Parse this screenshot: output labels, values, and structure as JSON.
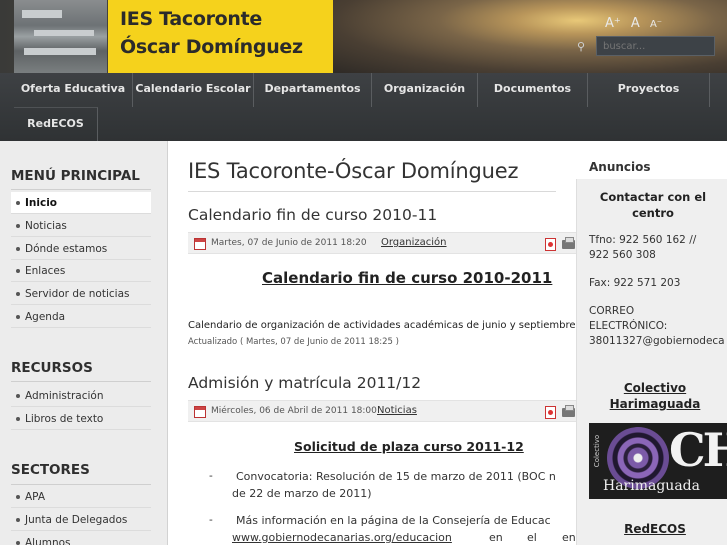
{
  "header": {
    "school_line1": "IES Tacoronte",
    "school_line2": "Óscar Domínguez",
    "font_controls": [
      "A⁺",
      "A",
      "A⁻"
    ],
    "search_placeholder": "buscar..."
  },
  "nav": {
    "items": [
      "Oferta Educativa",
      "Calendario Escolar",
      "Departamentos",
      "Organización",
      "Documentos",
      "Proyectos",
      "RedECOS"
    ]
  },
  "left_sidebar": {
    "sections": [
      {
        "title": "MENÚ PRINCIPAL",
        "items": [
          "Inicio",
          "Noticias",
          "Dónde estamos",
          "Enlaces",
          "Servidor de noticias",
          "Agenda"
        ]
      },
      {
        "title": "RECURSOS",
        "items": [
          "Administración",
          "Libros de texto"
        ]
      },
      {
        "title": "SECTORES",
        "items": [
          "APA",
          "Junta de Delegados",
          "Alumnos"
        ]
      }
    ]
  },
  "main": {
    "page_title": "IES Tacoronte-Óscar Domínguez",
    "articles": [
      {
        "title": "Calendario fin de curso 2010-11",
        "date": "Martes, 07 de Junio de 2011 18:20",
        "category": "Organización",
        "heading": "Calendario fin de curso 2010-2011",
        "body": "Calendario de organización de actividades académicas de junio y septiembre.",
        "updated": "Actualizado ( Martes, 07 de Junio de 2011 18:25 )"
      },
      {
        "title": "Admisión y matrícula 2011/12",
        "date": "Miércoles, 06 de Abril de 2011 18:00",
        "category": "Noticias",
        "heading": "Solicitud de plaza curso 2011-12",
        "bullets": [
          {
            "dash": "-",
            "line1": "Convocatoria: Resolución de 15 de marzo de 2011 (BOC n",
            "line2": "de 22 de marzo de 2011)"
          },
          {
            "dash": "-",
            "line1": "Más información en la página de la Consejería de Educac",
            "line2_link": "www.gobiernodecanarias.org/educacion",
            "line2_rest1": "en",
            "line2_rest2": "el",
            "line2_rest3": "en"
          }
        ]
      }
    ]
  },
  "right_sidebar": {
    "announcements_title": "Anuncios",
    "contact_heading": "Contactar con el centro",
    "phone_line1": "Tfno: 922 560 162 //",
    "phone_line2": "922 560 308",
    "fax": "Fax: 922 571 203",
    "email_label1": "CORREO",
    "email_label2": "ELECTRÓNICO:",
    "email_value": "38011327@gobiernodeca",
    "colectivo_link": "Colectivo Harimaguada",
    "harimaguada_image_text": "Harimaguada",
    "harimaguada_image_vertical": "Colectivo",
    "harimaguada_image_letters": "CH",
    "redecos_link": "RedECOS"
  }
}
